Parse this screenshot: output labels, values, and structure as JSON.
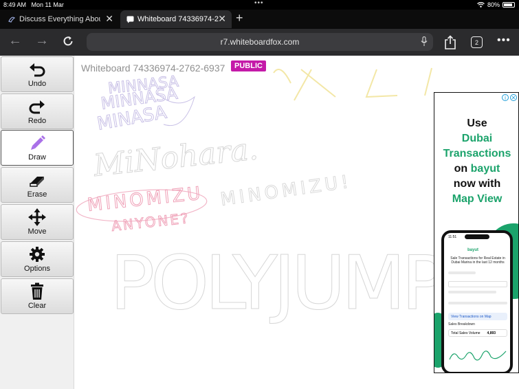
{
  "status": {
    "time": "8:49 AM",
    "date": "Mon 11 Mar",
    "battery": "80%"
  },
  "tabs": [
    {
      "label": "Discuss Everything Abou"
    },
    {
      "label": "Whiteboard 74336974-2"
    }
  ],
  "address": {
    "url": "r7.whiteboardfox.com",
    "tab_count": "2"
  },
  "toolbar": {
    "undo": "Undo",
    "redo": "Redo",
    "draw": "Draw",
    "erase": "Erase",
    "move": "Move",
    "options": "Options",
    "clear": "Clear"
  },
  "whiteboard": {
    "title": "Whiteboard 74336974-2762-6937",
    "badge": "PUBLIC"
  },
  "drawing_text": {
    "scribble1": "MINNASA",
    "scribble2": "MINNASA",
    "scribble3": "MINASA",
    "mi_nohara": "MiNohara.",
    "minomizu_pink": "MINOMIZU",
    "anyone": "ANYONE?",
    "minomizu_right": "MINOMIZU!",
    "polyjump": "POLYJUMP"
  },
  "ad": {
    "line1": "Use",
    "line2": "Dubai",
    "line3": "Transactions",
    "line4_on": "on",
    "line4_brand": "bayut",
    "line5": "now with",
    "line6": "Map View",
    "phone_time": "11:51",
    "phone_logo": "bayut",
    "phone_heading": "Sale Transactions for Real Estate in Dubai Marina in the last 12 months",
    "phone_button": "View Transactions on Map",
    "phone_label": "Sales Breakdown",
    "phone_row_label": "Total Sales Volume",
    "phone_row_value": "4,893"
  },
  "colors": {
    "badge": "#c41aa8",
    "ad_green": "#1ba36b",
    "draw_icon": "#a970e8"
  }
}
